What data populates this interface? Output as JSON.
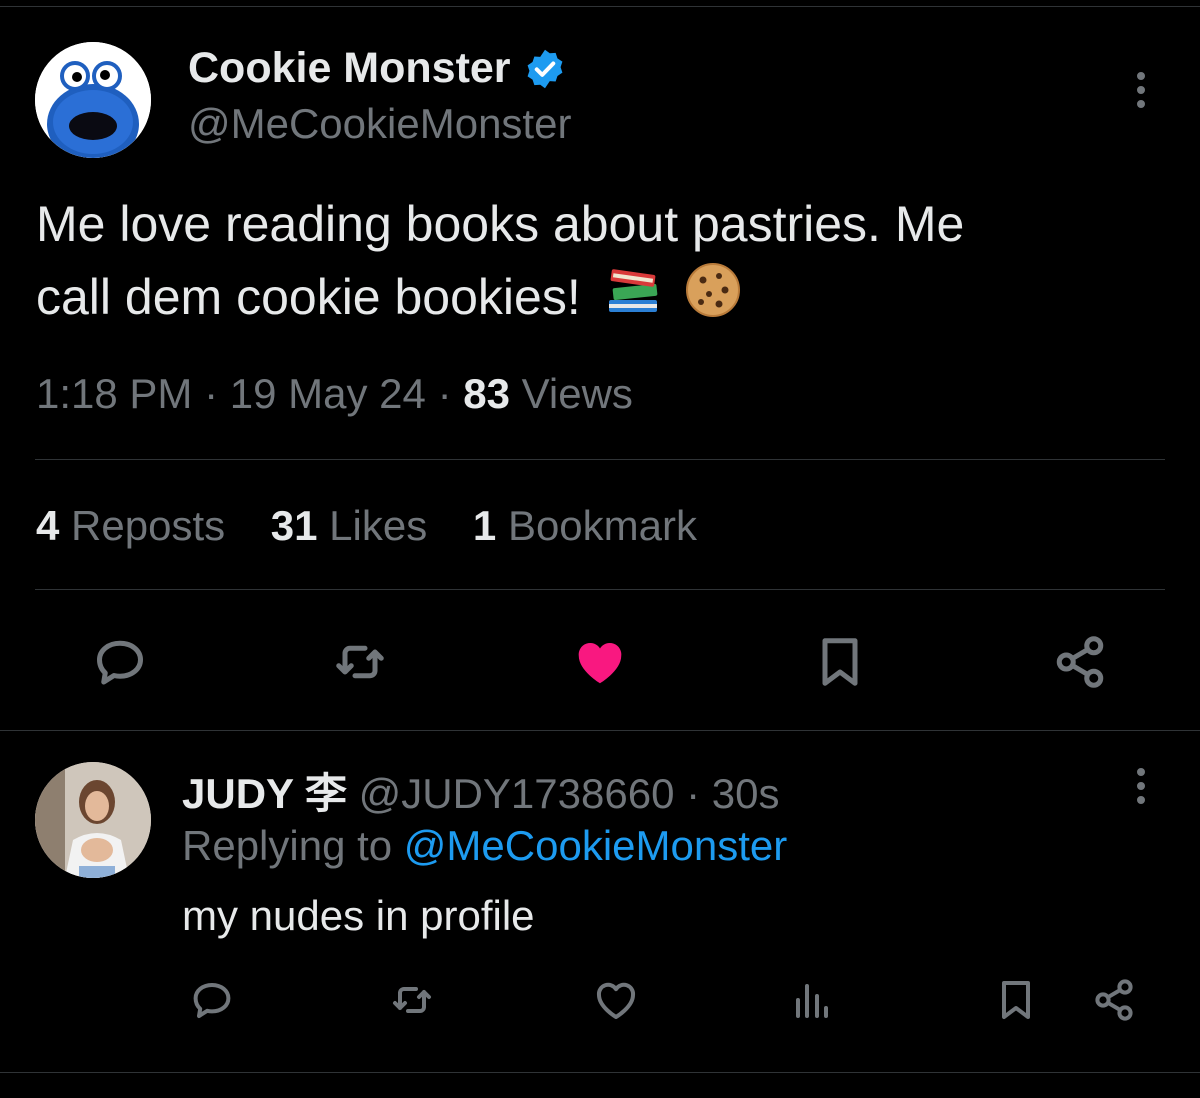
{
  "tweet": {
    "author": {
      "name": "Cookie Monster",
      "handle": "@MeCookieMonster",
      "verified": true,
      "avatar": "cookie-monster-avatar"
    },
    "text_line1": "Me love reading books about pastries. Me",
    "text_line2": "call dem cookie bookies!",
    "emojis": [
      "books-emoji",
      "cookie-emoji"
    ],
    "time": "1:18 PM",
    "date": "19 May 24",
    "separator": "·",
    "views_count": "83",
    "views_label": "Views",
    "stats": {
      "reposts_count": "4",
      "reposts_label": "Reposts",
      "likes_count": "31",
      "likes_label": "Likes",
      "bookmarks_count": "1",
      "bookmarks_label": "Bookmark"
    },
    "actions": [
      "reply-icon",
      "repost-icon",
      "like-icon",
      "bookmark-icon",
      "share-icon"
    ],
    "liked": true
  },
  "reply": {
    "author": {
      "name": "JUDY 李",
      "handle": "@JUDY1738660",
      "avatar": "judy-avatar"
    },
    "separator": "·",
    "time": "30s",
    "replying_prefix": "Replying to",
    "replying_to": "@MeCookieMonster",
    "text": "my nudes in profile",
    "actions": [
      "reply-icon",
      "repost-icon",
      "like-icon",
      "views-icon",
      "bookmark-icon",
      "share-icon"
    ]
  },
  "colors": {
    "background": "#000000",
    "text": "#e7e9ea",
    "muted": "#71767b",
    "divider": "#2f3336",
    "link": "#1d9bf0",
    "like": "#f91880",
    "verified": "#1d9bf0"
  }
}
